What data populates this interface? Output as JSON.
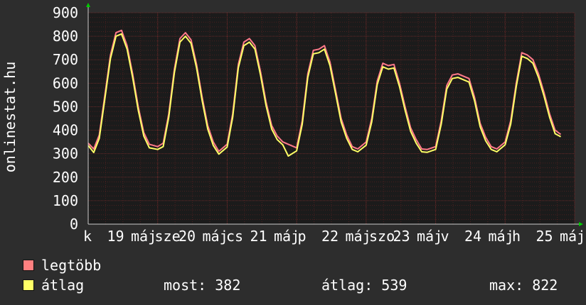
{
  "side_label": "onlinestat.hu",
  "colors": {
    "background": "#2d2d2d",
    "plot_background": "#1b1b1b",
    "grid_major": "#6a2a2a",
    "grid_minor": "#4a2020",
    "max_line": "#ff7a8a",
    "avg_line": "#ffff66",
    "arrow": "#00cc00",
    "text": "#ffffff"
  },
  "legend": [
    {
      "label": "legtöbb",
      "color": "#ff8080"
    },
    {
      "label": "átlag",
      "color": "#ffff66"
    }
  ],
  "stats": {
    "most": "most: 382",
    "atlag": "átlag: 539",
    "max": "max: 822"
  },
  "chart_data": {
    "type": "line",
    "title": "",
    "xlabel": "",
    "ylabel": "onlinestat.hu",
    "ylim": [
      0,
      900
    ],
    "yticks": [
      0,
      100,
      200,
      300,
      400,
      500,
      600,
      700,
      800,
      900
    ],
    "x_tick_labels": [
      "k",
      "19",
      "máj",
      "sze",
      "20",
      "máj",
      "cs",
      "21",
      "máj",
      "p",
      "22",
      "máj",
      "szo",
      "23",
      "máj",
      "v",
      "24",
      "máj",
      "h",
      "25",
      "máj"
    ],
    "grid": true,
    "legend_position": "bottom-left",
    "x": [
      0,
      0.08,
      0.16,
      0.24,
      0.32,
      0.4,
      0.48,
      0.56,
      0.64,
      0.72,
      0.8,
      0.88,
      1,
      1.08,
      1.16,
      1.24,
      1.32,
      1.4,
      1.48,
      1.56,
      1.64,
      1.72,
      1.8,
      1.88,
      2,
      2.08,
      2.16,
      2.24,
      2.32,
      2.4,
      2.48,
      2.56,
      2.64,
      2.72,
      2.8,
      2.88,
      3,
      3.08,
      3.16,
      3.24,
      3.32,
      3.4,
      3.48,
      3.56,
      3.64,
      3.72,
      3.8,
      3.88,
      4,
      4.08,
      4.16,
      4.24,
      4.32,
      4.4,
      4.48,
      4.56,
      4.64,
      4.72,
      4.8,
      4.88,
      5,
      5.08,
      5.16,
      5.24,
      5.32,
      5.4,
      5.48,
      5.56,
      5.64,
      5.72,
      5.8,
      5.88,
      6,
      6.08,
      6.16,
      6.24,
      6.32,
      6.4,
      6.48,
      6.56,
      6.64,
      6.72,
      6.8,
      6.88,
      6.96
    ],
    "series": [
      {
        "name": "legtöbb",
        "values": [
          345,
          320,
          380,
          550,
          720,
          815,
          825,
          760,
          640,
          500,
          390,
          340,
          330,
          345,
          470,
          660,
          790,
          815,
          785,
          680,
          540,
          420,
          350,
          310,
          340,
          470,
          680,
          775,
          790,
          760,
          650,
          520,
          420,
          375,
          350,
          340,
          325,
          440,
          640,
          740,
          745,
          760,
          690,
          570,
          450,
          380,
          330,
          320,
          350,
          450,
          610,
          685,
          675,
          680,
          600,
          500,
          410,
          360,
          320,
          318,
          330,
          440,
          590,
          635,
          640,
          630,
          620,
          540,
          430,
          370,
          330,
          320,
          350,
          440,
          600,
          730,
          720,
          700,
          640,
          560,
          470,
          400,
          382
        ]
      },
      {
        "name": "átlag",
        "values": [
          335,
          305,
          365,
          535,
          705,
          800,
          810,
          745,
          625,
          485,
          375,
          325,
          318,
          330,
          455,
          645,
          775,
          800,
          770,
          665,
          525,
          405,
          335,
          298,
          328,
          455,
          665,
          760,
          775,
          745,
          635,
          505,
          405,
          360,
          338,
          290,
          312,
          425,
          625,
          725,
          730,
          745,
          675,
          555,
          435,
          365,
          318,
          308,
          336,
          435,
          595,
          670,
          660,
          665,
          585,
          485,
          395,
          345,
          308,
          306,
          318,
          425,
          575,
          620,
          625,
          615,
          605,
          525,
          415,
          355,
          318,
          308,
          338,
          425,
          585,
          715,
          705,
          685,
          625,
          545,
          455,
          385,
          372
        ]
      }
    ]
  }
}
